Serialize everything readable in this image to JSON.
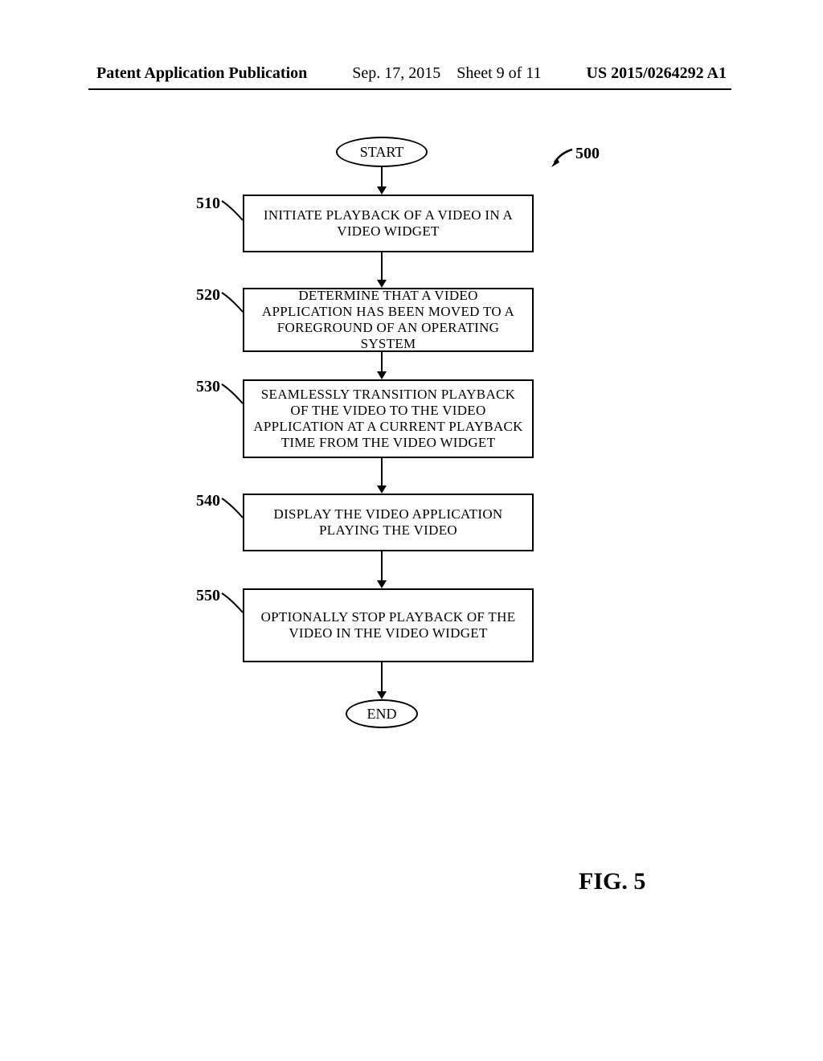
{
  "header": {
    "left": "Patent Application Publication",
    "center_date": "Sep. 17, 2015",
    "center_sheet": "Sheet 9 of 11",
    "right": "US 2015/0264292 A1"
  },
  "figure_number_ref": "500",
  "figure_caption": "FIG. 5",
  "start_label": "START",
  "end_label": "END",
  "steps": [
    {
      "num": "510",
      "text": "INITIATE PLAYBACK OF A VIDEO IN A VIDEO WIDGET"
    },
    {
      "num": "520",
      "text": "DETERMINE THAT A VIDEO APPLICATION HAS BEEN MOVED TO A FOREGROUND  OF AN OPERATING SYSTEM"
    },
    {
      "num": "530",
      "text": "SEAMLESSLY TRANSITION PLAYBACK OF THE VIDEO TO THE VIDEO APPLICATION AT A CURRENT PLAYBACK TIME FROM THE VIDEO WIDGET"
    },
    {
      "num": "540",
      "text": "DISPLAY THE VIDEO APPLICATION PLAYING THE VIDEO"
    },
    {
      "num": "550",
      "text": "OPTIONALLY STOP PLAYBACK OF THE VIDEO IN THE VIDEO WIDGET"
    }
  ]
}
